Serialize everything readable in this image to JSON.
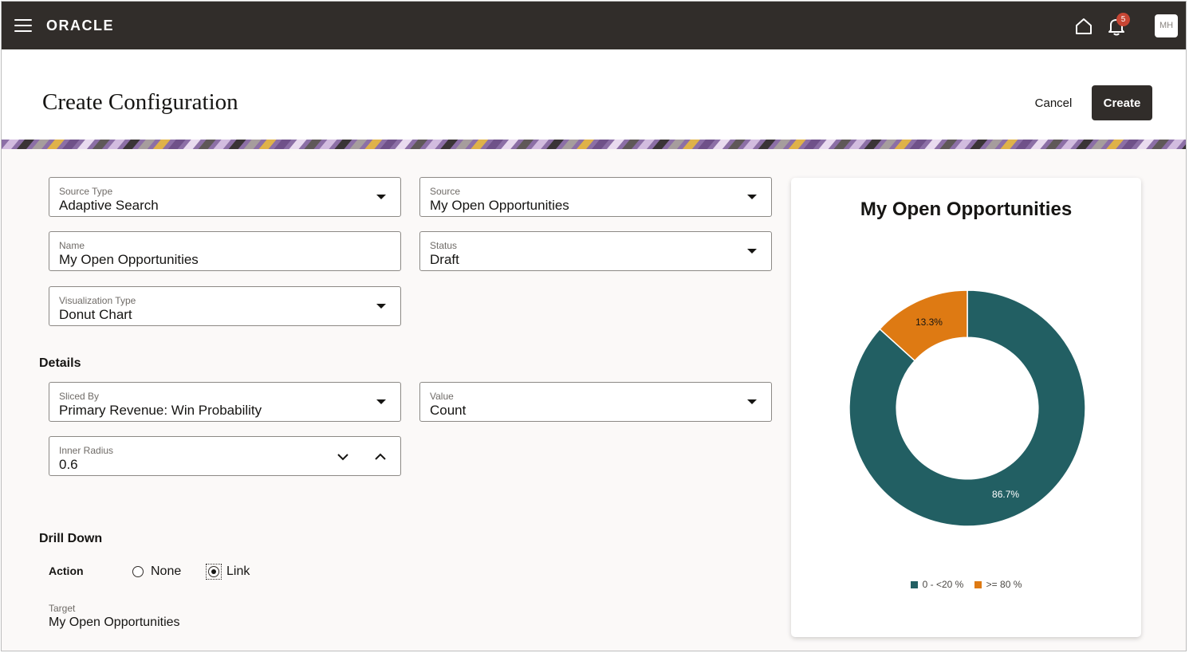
{
  "topbar": {
    "logo": "ORACLE",
    "notification_count": "5",
    "avatar_initials": "MH"
  },
  "header": {
    "title": "Create Configuration",
    "cancel_label": "Cancel",
    "create_label": "Create"
  },
  "form": {
    "source_type": {
      "label": "Source Type",
      "value": "Adaptive Search"
    },
    "source": {
      "label": "Source",
      "value": "My Open Opportunities"
    },
    "name": {
      "label": "Name",
      "value": "My Open Opportunities"
    },
    "status": {
      "label": "Status",
      "value": "Draft"
    },
    "visualization_type": {
      "label": "Visualization Type",
      "value": "Donut Chart"
    }
  },
  "details": {
    "title": "Details",
    "sliced_by": {
      "label": "Sliced By",
      "value": "Primary Revenue: Win Probability"
    },
    "value": {
      "label": "Value",
      "value": "Count"
    },
    "inner_radius": {
      "label": "Inner Radius",
      "value": "0.6"
    }
  },
  "drill_down": {
    "title": "Drill Down",
    "action_label": "Action",
    "options": [
      "None",
      "Link"
    ],
    "selected": "Link",
    "target_label": "Target",
    "target_value": "My Open Opportunities"
  },
  "colors": {
    "topbar": "#312d2a",
    "series_teal": "#225f63",
    "series_orange": "#de7a13"
  },
  "chart_data": {
    "type": "pie",
    "title": "My Open Opportunities",
    "categories": [
      "0 - <20 %",
      ">= 80 %"
    ],
    "values": [
      86.7,
      13.3
    ],
    "data_labels": [
      "86.7%",
      "13.3%"
    ],
    "colors": [
      "#225f63",
      "#de7a13"
    ],
    "inner_radius": 0.6,
    "legend_position": "bottom"
  }
}
